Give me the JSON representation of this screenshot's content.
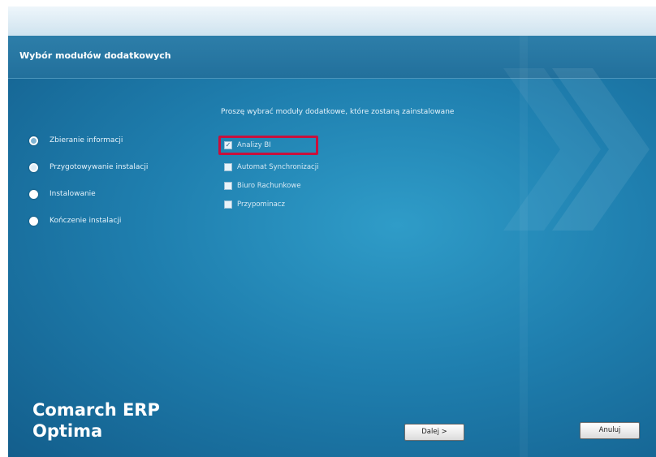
{
  "header": {
    "title": "Wybór modułów dodatkowych"
  },
  "steps": [
    {
      "label": "Zbieranie informacji",
      "state": "active"
    },
    {
      "label": "Przygotowywanie instalacji",
      "state": "semi"
    },
    {
      "label": "Instalowanie",
      "state": "pending"
    },
    {
      "label": "Kończenie instalacji",
      "state": "pending"
    }
  ],
  "main": {
    "prompt": "Proszę wybrać moduły dodatkowe, które zostaną zainstalowane",
    "modules": [
      {
        "label": "Analizy BI",
        "checked": true
      },
      {
        "label": "Automat Synchronizacji",
        "checked": false
      },
      {
        "label": "Biuro Rachunkowe",
        "checked": false
      },
      {
        "label": "Przypominacz",
        "checked": false
      }
    ]
  },
  "brand": {
    "line1": "Comarch ERP",
    "line2": "Optima"
  },
  "buttons": {
    "next": "Dalej >",
    "cancel": "Anuluj"
  },
  "colors": {
    "background": "#1f7faf",
    "highlight": "#c8103d"
  }
}
